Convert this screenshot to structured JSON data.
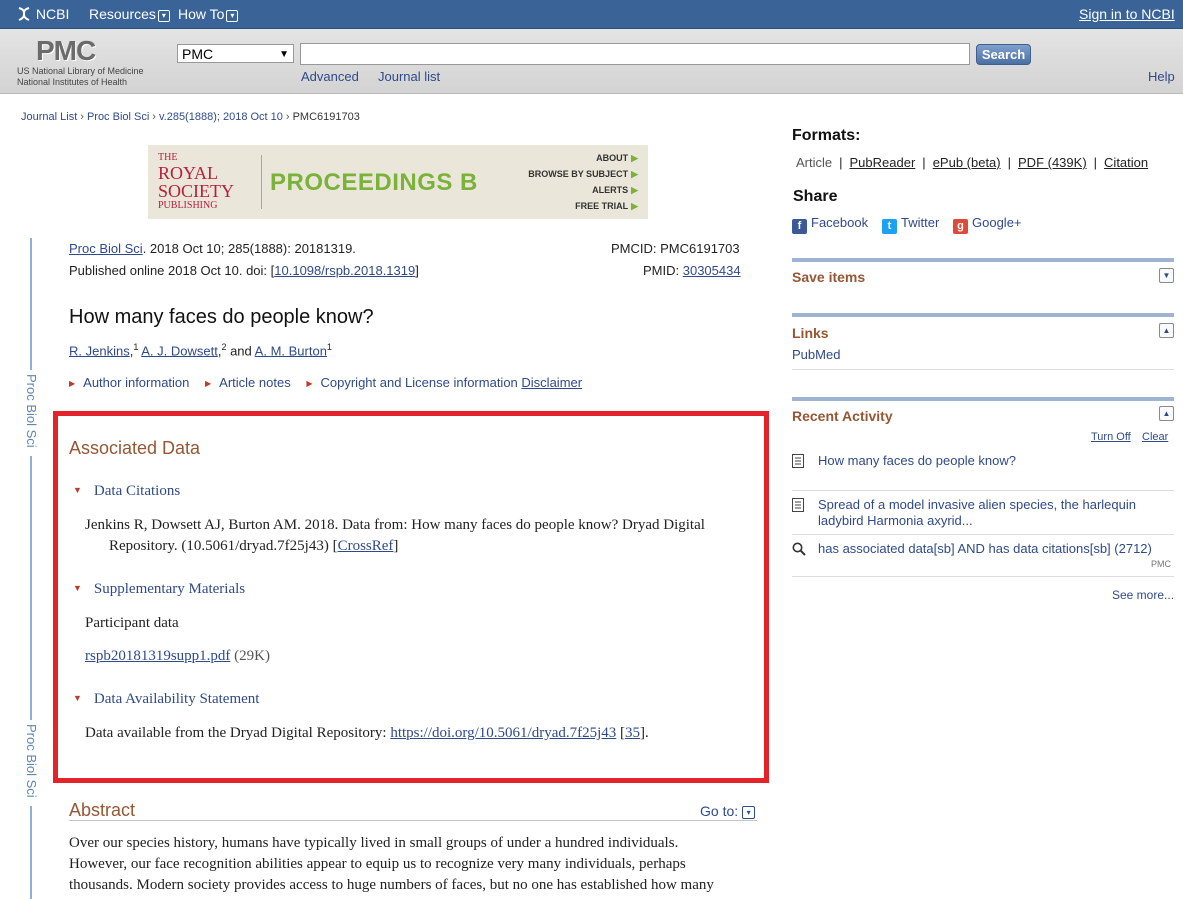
{
  "ncbi_bar": {
    "logo": "NCBI",
    "resources": "Resources",
    "howto": "How To",
    "signin": "Sign in to NCBI"
  },
  "header": {
    "logo": "PMC",
    "logo_sub1": "US National Library of Medicine",
    "logo_sub2": "National Institutes of Health",
    "db_select": "PMC",
    "search_value": "",
    "search_button": "Search",
    "advanced": "Advanced",
    "journal_list": "Journal list",
    "help": "Help"
  },
  "breadcrumb": {
    "items": [
      "Journal List",
      "Proc Biol Sci",
      "v.285(1888); 2018 Oct 10"
    ],
    "current": "PMC6191703"
  },
  "banner": {
    "royal": [
      "THE",
      "ROYAL",
      "SOCIETY",
      "PUBLISHING"
    ],
    "proceedings": "PROCEEDINGS B",
    "links": [
      "ABOUT",
      "BROWSE BY SUBJECT",
      "ALERTS",
      "FREE TRIAL"
    ]
  },
  "rail": {
    "label": "Proc Biol Sci"
  },
  "citation": {
    "journal": "Proc Biol Sci",
    "rest1": ". 2018 Oct 10; 285(1888): 20181319.",
    "published": "Published online 2018 Oct 10. doi:  [",
    "doi": "10.1098/rspb.2018.1319",
    "doi_close": "]",
    "pmcid": "PMCID: PMC6191703",
    "pmid_label": "PMID: ",
    "pmid": "30305434"
  },
  "article": {
    "title": "How many faces do people know?",
    "authors": [
      {
        "name": "R. Jenkins",
        "sup": "1"
      },
      {
        "name": "A. J. Dowsett",
        "sup": "2"
      },
      {
        "name": "A. M. Burton",
        "sup": "1"
      }
    ],
    "and": " and ",
    "info_links": [
      "Author information",
      "Article notes",
      "Copyright and License information"
    ],
    "disclaimer": "Disclaimer"
  },
  "associated_data": {
    "heading": "Associated Data",
    "data_citations": {
      "heading": "Data Citations",
      "line1": "Jenkins R, Dowsett AJ, Burton AM. 2018. Data from: How many faces do people know? Dryad Digital",
      "line2": "Repository. (10.5061/dryad.7f25j43) [",
      "crossref": "CrossRef",
      "close": "]"
    },
    "supplementary": {
      "heading": "Supplementary Materials",
      "label": "Participant data",
      "file": "rspb20181319supp1.pdf",
      "size": " (29K)"
    },
    "availability": {
      "heading": "Data Availability Statement",
      "text": "Data available from the Dryad Digital Repository: ",
      "url": "https://doi.org/10.5061/dryad.7f25j43",
      "ref_open": " [",
      "ref": "35",
      "ref_close": "]."
    }
  },
  "abstract": {
    "heading": "Abstract",
    "goto": "Go to:",
    "lines": [
      "Over our species history, humans have typically lived in small groups of under a hundred individuals.",
      "However, our face recognition abilities appear to equip us to recognize very many individuals, perhaps",
      "thousands. Modern society provides access to huge numbers of faces, but no one has established how many"
    ]
  },
  "sidebar": {
    "formats_title": "Formats:",
    "formats": [
      "Article",
      "PubReader",
      "ePub (beta)",
      "PDF (439K)",
      "Citation"
    ],
    "share_title": "Share",
    "share": [
      "Facebook",
      "Twitter",
      "Google+"
    ],
    "save_items": "Save items",
    "links_title": "Links",
    "links": [
      "PubMed"
    ],
    "recent_activity": "Recent Activity",
    "turn_off": "Turn Off",
    "clear": "Clear",
    "recent": [
      {
        "line1": "How many faces do people know?",
        "line2": ""
      },
      {
        "line1": "Spread of a model invasive alien species, the harlequin",
        "line2": "ladybird Harmonia axyrid..."
      },
      {
        "line1": "has associated data[sb] AND has data citations[sb] (2712)",
        "line2": ""
      }
    ],
    "recent_tag": "PMC",
    "see_more": "See more..."
  },
  "colors": {
    "ncbi_bar": "#3a6497",
    "highlight_box": "#e3222a",
    "section_heading": "#955734",
    "link": "#2f4a8a"
  }
}
